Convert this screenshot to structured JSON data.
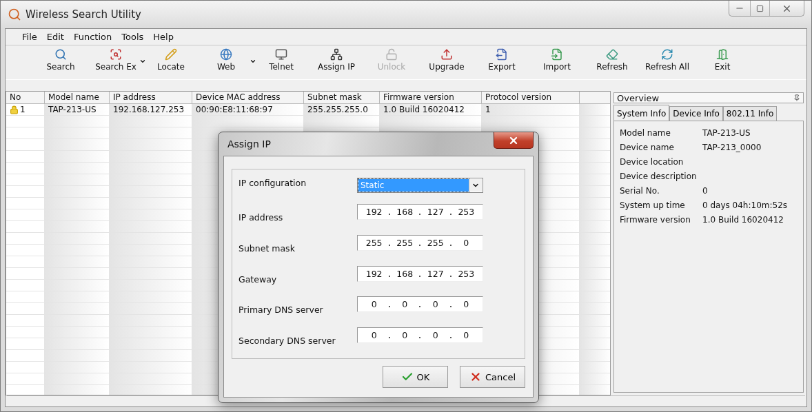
{
  "window": {
    "title": "Wireless Search Utility"
  },
  "menu": [
    "File",
    "Edit",
    "Function",
    "Tools",
    "Help"
  ],
  "toolbar": [
    {
      "label": "Search",
      "dropdown": false,
      "disabled": false
    },
    {
      "label": "Search Ex",
      "dropdown": true,
      "disabled": false
    },
    {
      "label": "Locate",
      "dropdown": false,
      "disabled": false
    },
    {
      "label": "Web",
      "dropdown": true,
      "disabled": false
    },
    {
      "label": "Telnet",
      "dropdown": false,
      "disabled": false
    },
    {
      "label": "Assign IP",
      "dropdown": false,
      "disabled": false
    },
    {
      "label": "Unlock",
      "dropdown": false,
      "disabled": true
    },
    {
      "label": "Upgrade",
      "dropdown": false,
      "disabled": false
    },
    {
      "label": "Export",
      "dropdown": false,
      "disabled": false
    },
    {
      "label": "Import",
      "dropdown": false,
      "disabled": false
    },
    {
      "label": "Refresh",
      "dropdown": false,
      "disabled": false
    },
    {
      "label": "Refresh All",
      "dropdown": false,
      "disabled": false
    },
    {
      "label": "Exit",
      "dropdown": false,
      "disabled": false
    }
  ],
  "table": {
    "columns": [
      "No",
      "Model name",
      "IP address",
      "Device MAC address",
      "Subnet mask",
      "Firmware version",
      "Protocol version"
    ],
    "rows": [
      {
        "cells": [
          "1",
          "TAP-213-US",
          "192.168.127.253",
          "00:90:E8:11:68:97",
          "255.255.255.0",
          "1.0 Build 16020412",
          "1"
        ]
      }
    ]
  },
  "overview": {
    "title": "Overview",
    "tabs": [
      {
        "label": "System Info",
        "selected": true
      },
      {
        "label": "Device Info",
        "selected": false
      },
      {
        "label": "802.11 Info",
        "selected": false
      }
    ],
    "fields": [
      {
        "label": "Model name",
        "value": "TAP-213-US"
      },
      {
        "label": "Device name",
        "value": "TAP-213_0000"
      },
      {
        "label": "Device location"
      },
      {
        "label": "Device description"
      },
      {
        "label": "Serial No.",
        "value": "0"
      },
      {
        "label": "System up time",
        "value": "0 days 04h:10m:52s"
      },
      {
        "label": "Firmware version",
        "value": "1.0 Build 16020412"
      }
    ]
  },
  "dialog": {
    "title": "Assign IP",
    "fields": [
      {
        "kind": "select",
        "label": "IP configuration",
        "value": "Static"
      },
      {
        "kind": "ip",
        "label": "IP address",
        "octets": [
          "192",
          "168",
          "127",
          "253"
        ]
      },
      {
        "kind": "ip",
        "label": "Subnet mask",
        "octets": [
          "255",
          "255",
          "255",
          "0"
        ]
      },
      {
        "kind": "ip",
        "label": "Gateway",
        "octets": [
          "192",
          "168",
          "127",
          "253"
        ]
      },
      {
        "kind": "ip",
        "label": "Primary DNS server",
        "octets": [
          "0",
          "0",
          "0",
          "0"
        ]
      },
      {
        "kind": "ip",
        "label": "Secondary DNS server",
        "octets": [
          "0",
          "0",
          "0",
          "0"
        ]
      }
    ],
    "buttons": [
      {
        "kind": "ok",
        "label": "OK"
      },
      {
        "kind": "cancel",
        "label": "Cancel"
      }
    ]
  }
}
